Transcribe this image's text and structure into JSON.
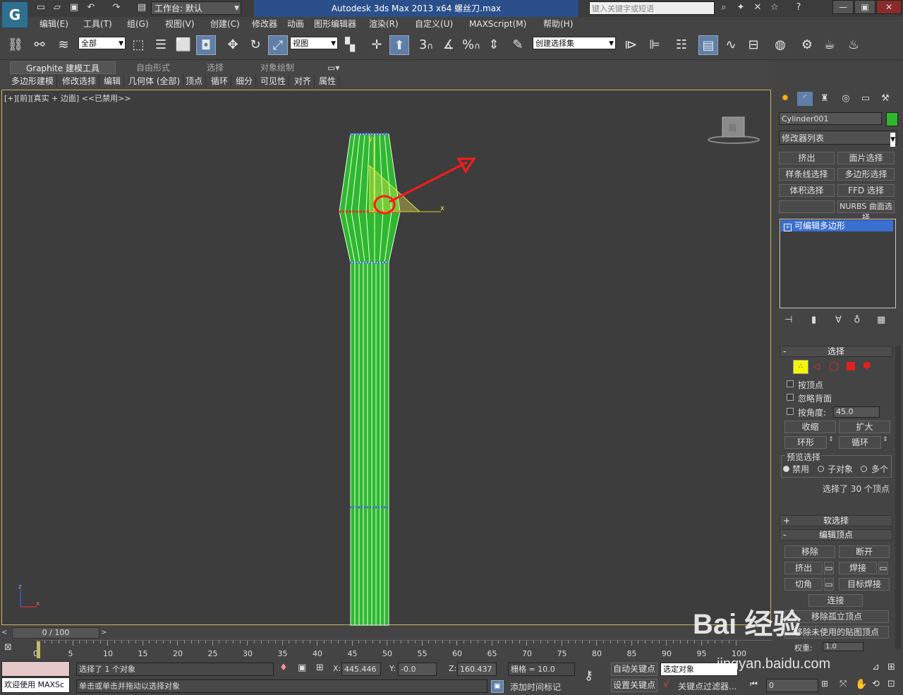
{
  "title": {
    "workspace_label": "工作台: 默认",
    "window_title": "Autodesk 3ds Max  2013 x64       螺丝刀.max",
    "search_placeholder": "键入关键字或短语"
  },
  "menu": [
    "编辑(E)",
    "工具(T)",
    "组(G)",
    "视图(V)",
    "创建(C)",
    "修改器",
    "动画",
    "图形编辑器",
    "渲染(R)",
    "自定义(U)",
    "MAXScript(M)",
    "帮助(H)"
  ],
  "toolbar": {
    "selection_filter": "全部",
    "ref_coord": "视图",
    "named_selection": "创建选择集",
    "snap_3": "3",
    "snap_percent": "%"
  },
  "ribbon": {
    "tabs": [
      "Graphite 建模工具",
      "自由形式",
      "选择",
      "对象绘制"
    ],
    "subtabs": [
      "多边形建模",
      "修改选择",
      "编辑",
      "几何体 (全部)",
      "顶点",
      "循环",
      "细分",
      "可见性",
      "对齐",
      "属性"
    ]
  },
  "viewport": {
    "label": "[+][前][真实 + 边面] <<已禁用>>",
    "cube_label": "前",
    "gizmo_x": "x",
    "gizmo_y": "y",
    "axis_z": "z",
    "axis_x": "x"
  },
  "command_panel": {
    "object_name": "Cylinder001",
    "object_color": "#2db82d",
    "modifier_list": "修改器列表",
    "mod_buttons": [
      "挤出",
      "面片选择",
      "样条线选择",
      "多边形选择",
      "体积选择",
      "FFD 选择",
      "",
      "NURBS 曲面选择"
    ],
    "stack_item": "可编辑多边形",
    "selection_title": "选择",
    "by_vertex": "按顶点",
    "ignore_backfacing": "忽略背面",
    "by_angle": "按角度:",
    "angle_value": "45.0",
    "shrink": "收缩",
    "grow": "扩大",
    "ring": "环形",
    "loop": "循环",
    "preview_title": "预览选择",
    "preview_options": [
      "禁用",
      "子对象",
      "多个"
    ],
    "selected_info": "选择了 30 个顶点",
    "soft_selection": "软选择",
    "edit_vertices": "编辑顶点",
    "ev_buttons": [
      "移除",
      "断开",
      "挤出",
      "焊接",
      "切角",
      "目标焊接"
    ],
    "connect": "连接",
    "remove_isolated": "移除孤立顶点",
    "remove_unused_map": "移除未使用的贴图顶点",
    "weight_label": "权重:",
    "weight_value": "1.0"
  },
  "timeline": {
    "frame_display": "0 / 100",
    "ticks": [
      "0",
      "5",
      "10",
      "15",
      "20",
      "25",
      "30",
      "35",
      "40",
      "45",
      "50",
      "55",
      "60",
      "65",
      "70",
      "75",
      "80",
      "85",
      "90",
      "95",
      "100"
    ]
  },
  "status": {
    "listener": "欢迎使用 MAXSc",
    "selection_status": "选择了 1 个对象",
    "prompt": "单击或单击并拖动以选择对象",
    "x_label": "X:",
    "x_value": "445.446",
    "y_label": "Y:",
    "y_value": "-0.0",
    "z_label": "Z:",
    "z_value": "160.437",
    "grid": "栅格 = 10.0",
    "add_time_tag": "添加时间标记",
    "auto_key": "自动关键点",
    "set_key": "设置关键点",
    "key_mode": "选定对象",
    "key_filters": "关键点过滤器...",
    "frame_value": "0"
  },
  "watermark": {
    "text": "Bai 经验",
    "url": "jingyan.baidu.com"
  }
}
